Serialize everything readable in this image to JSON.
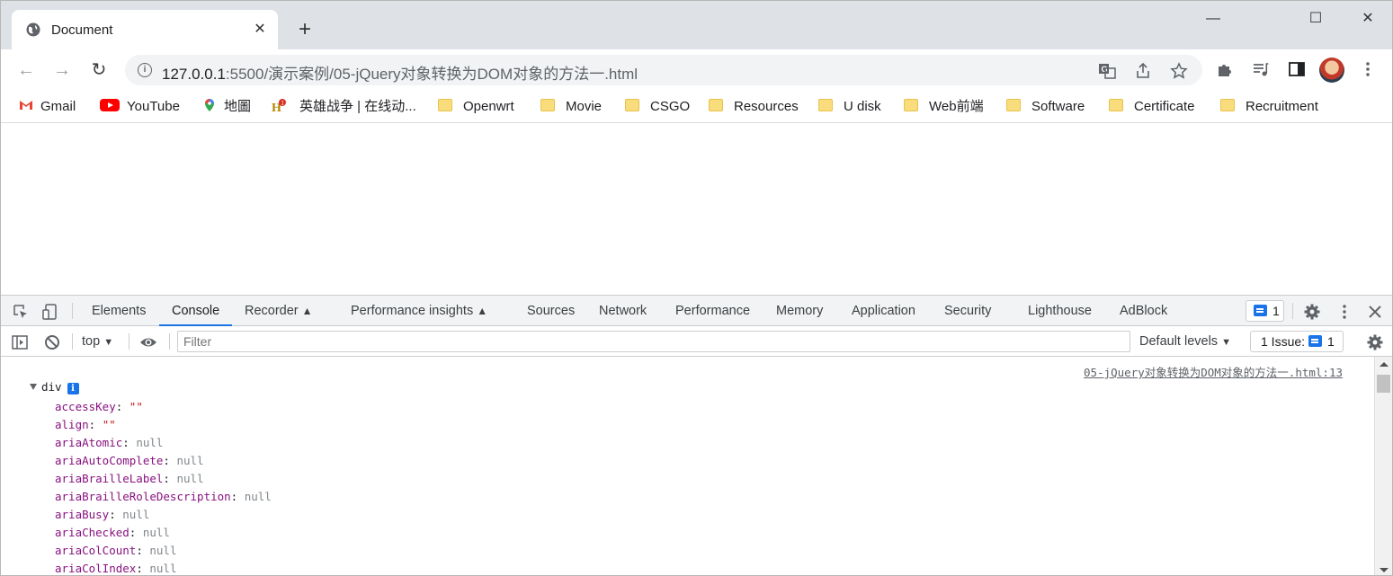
{
  "tab": {
    "title": "Document",
    "close": "✕",
    "new_tab": "+"
  },
  "window": {
    "minimize": "—",
    "maximize": "☐",
    "close": "✕"
  },
  "nav": {
    "back": "←",
    "forward": "→",
    "reload": "↻"
  },
  "address": {
    "host": "127.0.0.1",
    "path": ":5500/演示案例/05-jQuery对象转换为DOM对象的方法一.html"
  },
  "bookmarks": [
    {
      "label": "Gmail",
      "icon": "gmail-icon"
    },
    {
      "label": "YouTube",
      "icon": "youtube-icon"
    },
    {
      "label": "地圖",
      "icon": "maps-icon"
    },
    {
      "label": "英雄战争 | 在线动...",
      "icon": "game-icon"
    },
    {
      "label": "Openwrt",
      "icon": "folder-icon"
    },
    {
      "label": "Movie",
      "icon": "folder-icon"
    },
    {
      "label": "CSGO",
      "icon": "folder-icon"
    },
    {
      "label": "Resources",
      "icon": "folder-icon"
    },
    {
      "label": "U disk",
      "icon": "folder-icon"
    },
    {
      "label": "Web前端",
      "icon": "folder-icon"
    },
    {
      "label": "Software",
      "icon": "folder-icon"
    },
    {
      "label": "Certificate",
      "icon": "folder-icon"
    },
    {
      "label": "Recruitment",
      "icon": "folder-icon"
    }
  ],
  "devtools": {
    "tabs": [
      "Elements",
      "Console",
      "Recorder",
      "Performance insights",
      "Sources",
      "Network",
      "Performance",
      "Memory",
      "Application",
      "Security",
      "Lighthouse",
      "AdBlock"
    ],
    "active_tab": "Console",
    "message_count": "1",
    "context": "top",
    "filter_placeholder": "Filter",
    "levels": "Default levels",
    "issues": "1 Issue:",
    "issues_count": "1"
  },
  "console": {
    "source_link": "05-jQuery对象转换为DOM对象的方法一.html:13",
    "object_label": "div",
    "info_badge": "i",
    "properties": [
      {
        "key": "accessKey",
        "value": "\"\"",
        "type": "string"
      },
      {
        "key": "align",
        "value": "\"\"",
        "type": "string"
      },
      {
        "key": "ariaAtomic",
        "value": "null",
        "type": "null"
      },
      {
        "key": "ariaAutoComplete",
        "value": "null",
        "type": "null"
      },
      {
        "key": "ariaBrailleLabel",
        "value": "null",
        "type": "null"
      },
      {
        "key": "ariaBrailleRoleDescription",
        "value": "null",
        "type": "null"
      },
      {
        "key": "ariaBusy",
        "value": "null",
        "type": "null"
      },
      {
        "key": "ariaChecked",
        "value": "null",
        "type": "null"
      },
      {
        "key": "ariaColCount",
        "value": "null",
        "type": "null"
      },
      {
        "key": "ariaColIndex",
        "value": "null",
        "type": "null"
      }
    ]
  }
}
